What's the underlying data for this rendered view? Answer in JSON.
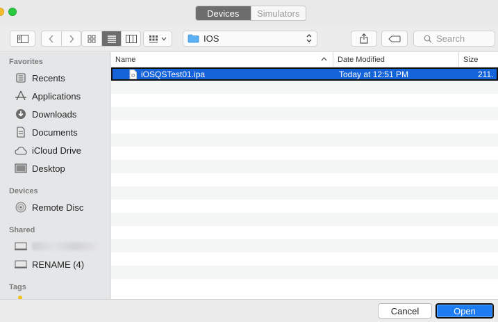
{
  "window": {
    "tabs": [
      {
        "label": "Devices",
        "active": true
      },
      {
        "label": "Simulators",
        "active": false
      }
    ]
  },
  "toolbar": {
    "path_label": "IOS",
    "search_placeholder": "Search"
  },
  "sidebar": {
    "favorites_header": "Favorites",
    "favorites": [
      {
        "label": "Recents",
        "icon": "recents-icon"
      },
      {
        "label": "Applications",
        "icon": "applications-icon"
      },
      {
        "label": "Downloads",
        "icon": "downloads-icon"
      },
      {
        "label": "Documents",
        "icon": "documents-icon"
      },
      {
        "label": "iCloud Drive",
        "icon": "icloud-icon"
      },
      {
        "label": "Desktop",
        "icon": "desktop-icon"
      }
    ],
    "devices_header": "Devices",
    "devices": [
      {
        "label": "Remote Disc",
        "icon": "disc-icon"
      }
    ],
    "shared_header": "Shared",
    "shared": [
      {
        "label": "",
        "icon": "network-computer-icon",
        "obscured": true
      },
      {
        "label": "RENAME (4)",
        "icon": "network-computer-icon"
      }
    ],
    "tags_header": "Tags"
  },
  "filelist": {
    "columns": {
      "name": "Name",
      "date": "Date Modified",
      "size": "Size"
    },
    "rows": [
      {
        "name": "iOSQSTest01.ipa",
        "date": "Today at 12:51 PM",
        "size": "211.",
        "selected": true
      }
    ]
  },
  "buttons": {
    "cancel": "Cancel",
    "open": "Open"
  },
  "colors": {
    "selection": "#1563d8",
    "primary_button": "#1e7cf2",
    "segment_active": "#6d6d6d"
  }
}
